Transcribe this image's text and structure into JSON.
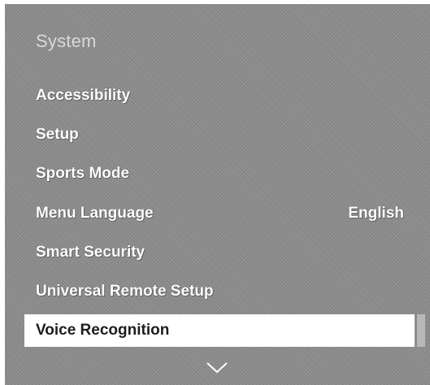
{
  "header": {
    "title": "System"
  },
  "menu": {
    "items": [
      {
        "label": "Accessibility",
        "value": ""
      },
      {
        "label": "Setup",
        "value": ""
      },
      {
        "label": "Sports Mode",
        "value": ""
      },
      {
        "label": "Menu Language",
        "value": "English"
      },
      {
        "label": "Smart Security",
        "value": ""
      },
      {
        "label": "Universal Remote Setup",
        "value": ""
      },
      {
        "label": "Voice Recognition",
        "value": "",
        "selected": true
      }
    ]
  },
  "icons": {
    "scroll_down": "chevron-down-icon"
  },
  "colors": {
    "background": "#8e8e8e",
    "selected_bg": "#ffffff",
    "selected_text": "#1e1e1e",
    "text": "#ffffff"
  }
}
